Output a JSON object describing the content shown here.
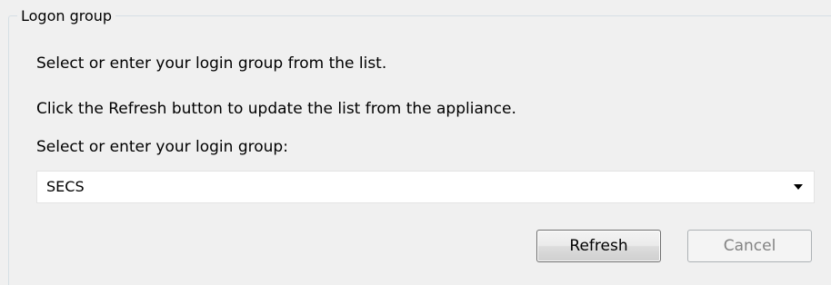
{
  "groupbox": {
    "legend": "Logon group"
  },
  "instructions": {
    "line1": "Select or enter your login group from the list.",
    "line2": "Click the Refresh button to update the list from the appliance.",
    "combo_label": "Select or enter your login group:"
  },
  "combo": {
    "value": "SECS",
    "icon": "chevron-down-icon"
  },
  "buttons": {
    "refresh_label": "Refresh",
    "cancel_label": "Cancel",
    "cancel_enabled": false
  },
  "colors": {
    "panel_background": "#f0f0f0",
    "groupbox_border": "#d5dfe5",
    "disabled_text": "#838383"
  }
}
